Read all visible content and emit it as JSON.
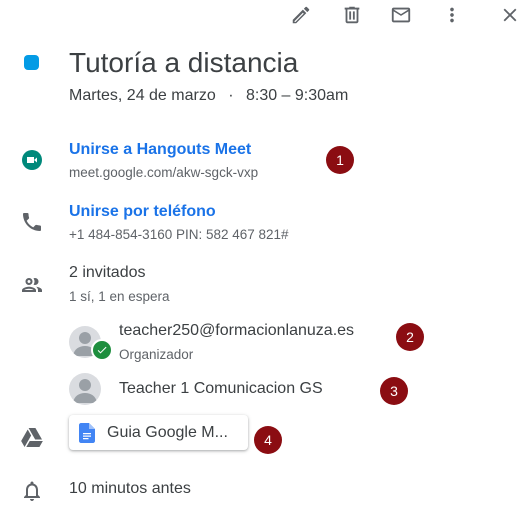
{
  "toolbar": {
    "edit_icon": "pencil-icon",
    "delete_icon": "trash-icon",
    "email_icon": "mail-icon",
    "more_icon": "more-vertical-icon",
    "close_icon": "close-icon"
  },
  "event": {
    "color": "#039be5",
    "title": "Tutoría a distancia",
    "date": "Martes, 24 de marzo",
    "separator": "·",
    "time": "8:30 – 9:30am"
  },
  "meet": {
    "link_label": "Unirse a Hangouts Meet",
    "url": "meet.google.com/akw-sgck-vxp"
  },
  "phone": {
    "link_label": "Unirse por teléfono",
    "details": "+1 484-854-3160 PIN: 582 467 821#"
  },
  "guests": {
    "count_label": "2 invitados",
    "status": "1 sí, 1 en espera",
    "list": [
      {
        "name": "teacher250@formacionlanuza.es",
        "role": "Organizador"
      },
      {
        "name": "Teacher 1 Comunicacion GS",
        "role": ""
      }
    ]
  },
  "attachment": {
    "name": "Guia Google M..."
  },
  "notification": {
    "label": "10 minutos antes"
  },
  "markers": [
    "1",
    "2",
    "3",
    "4"
  ]
}
